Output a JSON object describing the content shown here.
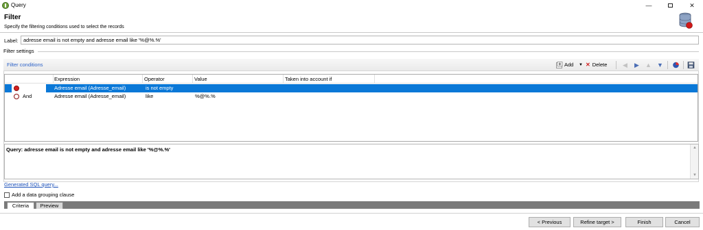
{
  "window": {
    "title": "Query",
    "controls": {
      "minimize": "—",
      "maximize": "",
      "close": "✕"
    }
  },
  "header": {
    "title": "Filter",
    "subtitle": "Specify the filtering conditions used to select the records",
    "icon": "database-icon"
  },
  "label_field": {
    "label": "Label:",
    "value": "adresse email is not empty and adresse email like '%@%.%'"
  },
  "filter_settings": {
    "heading": "Filter settings",
    "conditions_link": "Filter conditions",
    "toolbar": {
      "add_label": "Add",
      "delete_label": "Delete",
      "icons": [
        "arrow-left-icon",
        "arrow-right-icon",
        "arrow-up-icon",
        "arrow-down-icon",
        "pie-chart-icon",
        "save-icon"
      ]
    },
    "grid": {
      "columns": [
        "Expression",
        "Operator",
        "Value",
        "Taken into account if"
      ],
      "rows": [
        {
          "connector": "",
          "expression": "Adresse email (Adresse_email)",
          "operator": "is not empty",
          "value": "",
          "condition": "",
          "selected": true
        },
        {
          "connector": "And",
          "expression": "Adresse email (Adresse_email)",
          "operator": "like",
          "value": "%@%.%",
          "condition": "",
          "selected": false
        }
      ]
    },
    "query_text": "Query: adresse email is not empty and adresse email like '%@%.%'"
  },
  "links": {
    "generated_sql": "Generated SQL query..."
  },
  "grouping": {
    "label": "Add a data grouping clause",
    "checked": false
  },
  "tabs": [
    {
      "label": "Criteria",
      "active": true
    },
    {
      "label": "Preview",
      "active": false
    }
  ],
  "buttons": {
    "previous": "< Previous",
    "refine": "Refine target >",
    "finish": "Finish",
    "cancel": "Cancel"
  },
  "colors": {
    "selection": "#0a78d7",
    "link": "#2e63c8",
    "condition_icon": "#d42020"
  }
}
